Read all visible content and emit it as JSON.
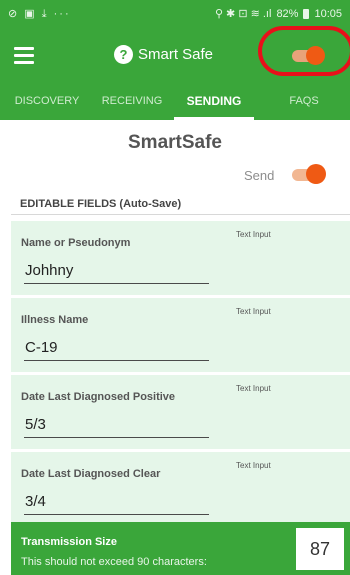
{
  "status_bar": {
    "left_icons": "⊘ ▣ ⤓ ···",
    "right_icons": "⚲ ✱ ⊡ ≋ .ıl",
    "battery": "82%",
    "time": "10:05"
  },
  "app_bar": {
    "title": "Smart Safe",
    "menu_icon": "hamburger-menu-icon",
    "help_icon": "?",
    "toggle_on": true,
    "accent": "#3aa63a",
    "toggle_color": "#ef5a14",
    "highlight_color": "#e8101a"
  },
  "tabs": [
    {
      "label": "DISCOVERY",
      "active": false
    },
    {
      "label": "RECEIVING",
      "active": false
    },
    {
      "label": "SENDING",
      "active": true
    },
    {
      "label": "FAQS",
      "active": false
    }
  ],
  "main": {
    "title": "SmartSafe",
    "send_label": "Send",
    "send_on": true,
    "section_header": "EDITABLE FIELDS (Auto-Save)",
    "fields": [
      {
        "label": "Name or Pseudonym",
        "type": "Text Input",
        "value": "Johhny"
      },
      {
        "label": "Illness Name",
        "type": "Text Input",
        "value": "C-19"
      },
      {
        "label": "Date Last Diagnosed Positive",
        "type": "Text Input",
        "value": "5/3"
      },
      {
        "label": "Date Last Diagnosed Clear",
        "type": "Text Input",
        "value": "3/4"
      }
    ]
  },
  "footer": {
    "title": "Transmission Size",
    "subtitle": "This should not exceed 90 characters:",
    "count": "87"
  }
}
